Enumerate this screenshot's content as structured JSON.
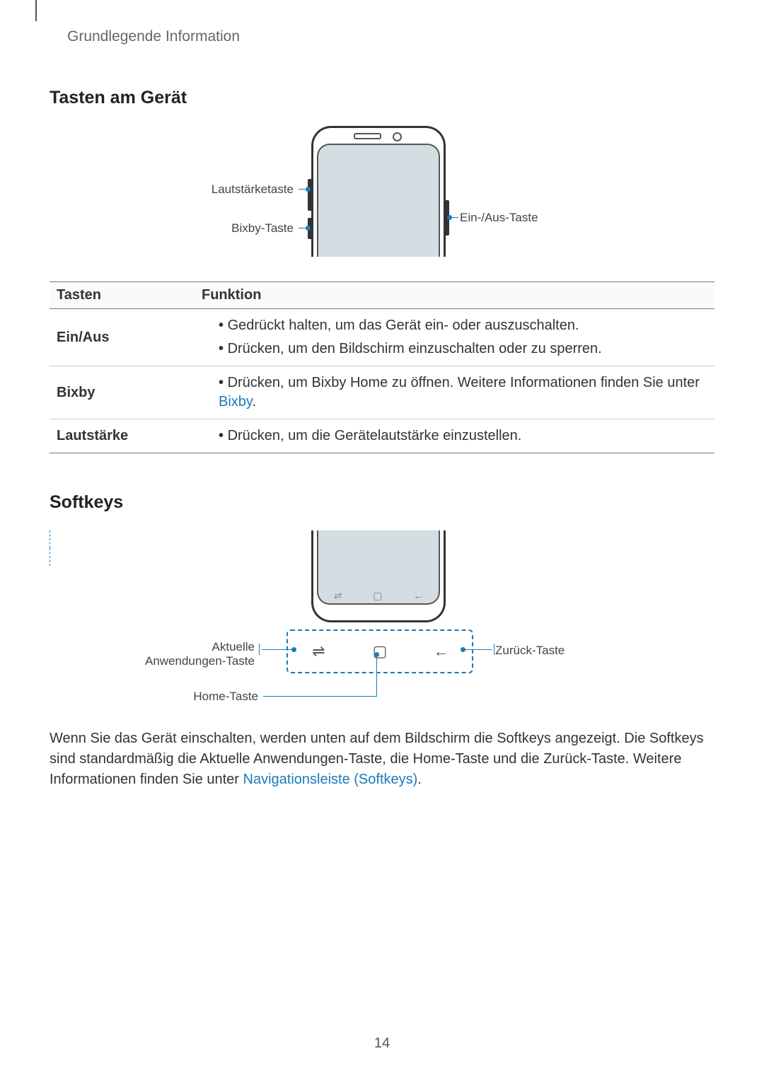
{
  "breadcrumb": "Grundlegende Information",
  "heading1": "Tasten am Gerät",
  "diagram1": {
    "volume": "Lautstärketaste",
    "bixby": "Bixby-Taste",
    "power": "Ein-/Aus-Taste"
  },
  "table": {
    "head": {
      "c1": "Tasten",
      "c2": "Funktion"
    },
    "rows": [
      {
        "key": "Ein/Aus",
        "items": [
          "Gedrückt halten, um das Gerät ein- oder auszuschalten.",
          "Drücken, um den Bildschirm einzuschalten oder zu sperren."
        ]
      },
      {
        "key": "Bixby",
        "items_pre": "Drücken, um Bixby Home zu öffnen. Weitere Informationen finden Sie unter ",
        "link": "Bixby",
        "items_post": "."
      },
      {
        "key": "Lautstärke",
        "items": [
          "Drücken, um die Gerätelautstärke einzustellen."
        ]
      }
    ]
  },
  "heading2": "Softkeys",
  "diagram2": {
    "recents_l1": "Aktuelle",
    "recents_l2": "Anwendungen-Taste",
    "home": "Home-Taste",
    "back": "Zurück-Taste",
    "icon_recents": "⇌",
    "icon_home": "▢",
    "icon_back": "←"
  },
  "paragraph_pre": "Wenn Sie das Gerät einschalten, werden unten auf dem Bildschirm die Softkeys angezeigt. Die Softkeys sind standardmäßig die Aktuelle Anwendungen-Taste, die Home-Taste und die Zurück-Taste. Weitere Informationen finden Sie unter ",
  "paragraph_link": "Navigationsleiste (Softkeys)",
  "paragraph_post": ".",
  "page_number": "14"
}
